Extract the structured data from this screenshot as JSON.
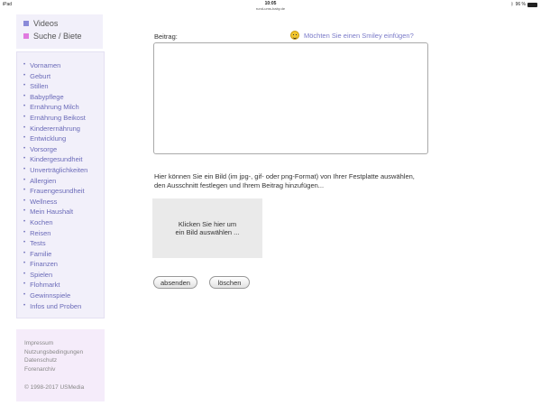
{
  "statusbar": {
    "device": "iPad",
    "time": "10:05",
    "url": "rund-ums-baby.de",
    "battery_text": "96 %",
    "battery_level": 0.96
  },
  "sidebar": {
    "categories": [
      {
        "label": "Videos",
        "color": "#8a8ad8"
      },
      {
        "label": "Suche / Biete",
        "color": "#e07adf"
      }
    ],
    "nav_items": [
      "Vornamen",
      "Geburt",
      "Stillen",
      "Babypflege",
      "Ernährung Milch",
      "Ernährung Beikost",
      "Kinderernährung",
      "Entwicklung",
      "Vorsorge",
      "Kindergesundheit",
      "Unverträglichkeiten",
      "Allergien",
      "Frauengesundheit",
      "Wellness",
      "Mein Haushalt",
      "Kochen",
      "Reisen",
      "Tests",
      "Familie",
      "Finanzen",
      "Spielen",
      "Flohmarkt",
      "Gewinnspiele",
      "Infos und Proben"
    ],
    "footer_links": [
      "Impressum",
      "Nutzungsbedingungen",
      "Datenschutz",
      "Forenarchiv"
    ],
    "copyright": "© 1998-2017 USMedia"
  },
  "form": {
    "beitrag_label": "Beitrag:",
    "smiley_link": "Möchten Sie einen Smiley einfügen?",
    "textarea_value": "",
    "upload_info": "Hier können Sie ein Bild (im jpg-, gif- oder png-Format) von Ihrer Festplatte auswählen, den Ausschnitt festlegen und Ihrem Beitrag hinzufügen...",
    "image_box_line1": "Klicken Sie hier um",
    "image_box_line2": "ein Bild auswählen ...",
    "submit_label": "absenden",
    "delete_label": "löschen"
  }
}
